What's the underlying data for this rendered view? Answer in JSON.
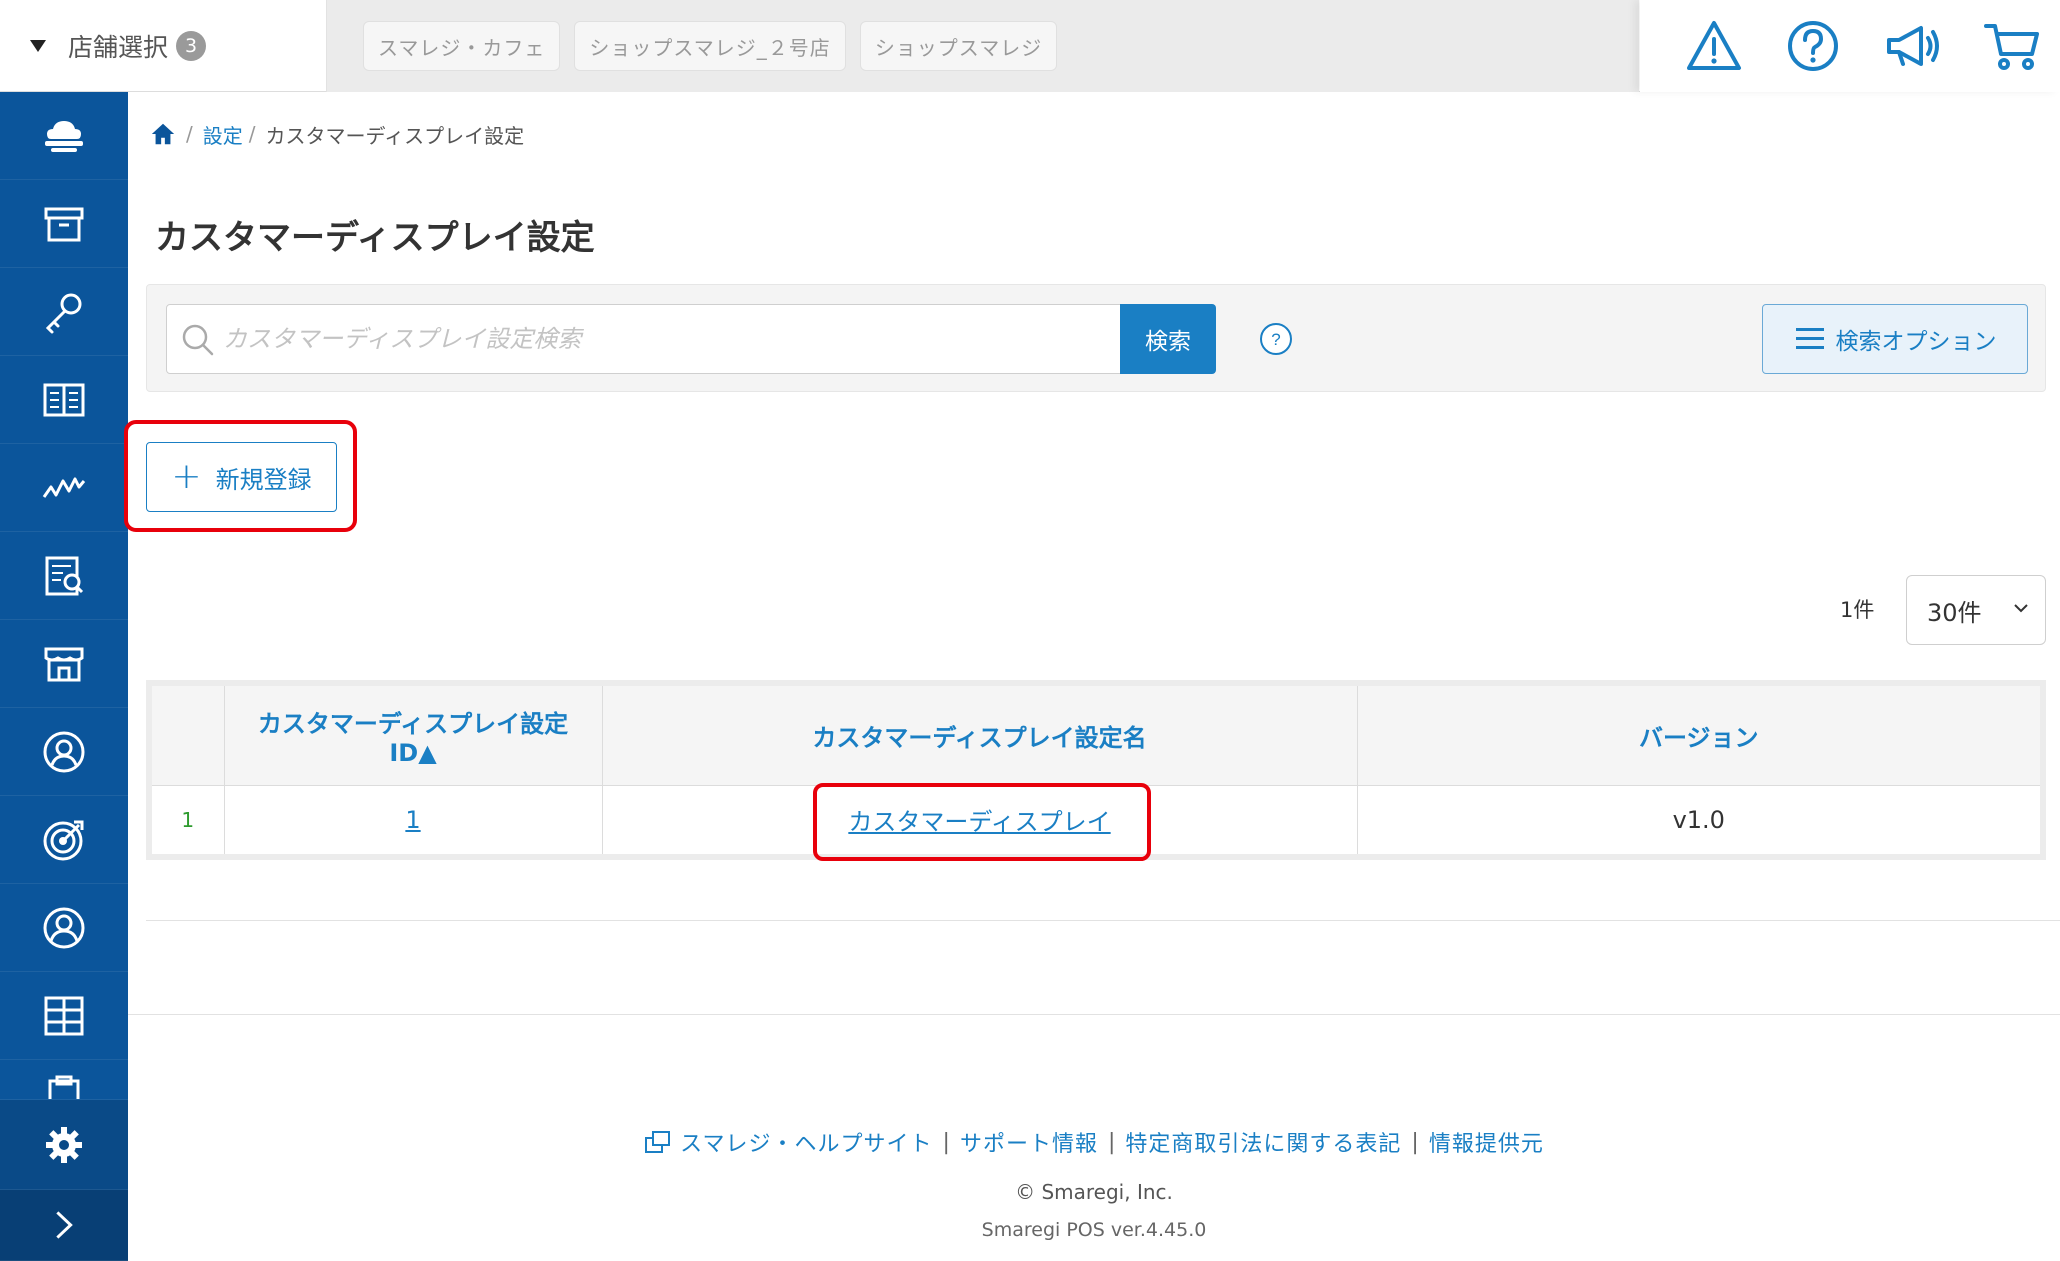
{
  "header": {
    "store_select_label": "店舗選択",
    "store_count": "3",
    "shop_tabs": [
      "スマレジ・カフェ",
      "ショップスマレジ_２号店",
      "ショップスマレジ"
    ],
    "icons": [
      "warning-icon",
      "help-icon",
      "megaphone-icon",
      "cart-icon"
    ]
  },
  "sidebar": {
    "items": [
      "cloud-icon",
      "box-icon",
      "key-icon",
      "book-icon",
      "chart-icon",
      "report-icon",
      "store-icon",
      "customer-icon",
      "target-icon",
      "user-icon",
      "grid-icon",
      "clipboard-icon"
    ],
    "bottom": [
      "gear-icon",
      "chevron-right-icon"
    ],
    "color": "#0b559b"
  },
  "breadcrumb": {
    "home_icon": "home-icon",
    "settings": "設定",
    "separator": "/",
    "current": "カスタマーディスプレイ設定"
  },
  "page": {
    "title": "カスタマーディスプレイ設定"
  },
  "search": {
    "placeholder": "カスタマーディスプレイ設定検索",
    "button": "検索",
    "help": "?",
    "options_button": "検索オプション"
  },
  "actions": {
    "new_button": "新規登録"
  },
  "pagination": {
    "count": "1件",
    "per_page": "30件"
  },
  "table": {
    "headers": [
      "",
      "カスタマーディスプレイ設定\nID▲",
      "カスタマーディスプレイ設定名",
      "バージョン"
    ],
    "header_id_line1": "カスタマーディスプレイ設定",
    "header_id_line2": "ID▲",
    "rows": [
      {
        "num": "1",
        "id": "1",
        "name": "カスタマーディスプレイ",
        "version": "v1.0"
      }
    ]
  },
  "footer": {
    "links": [
      "スマレジ・ヘルプサイト",
      "サポート情報",
      "特定商取引法に関する表記",
      "情報提供元"
    ],
    "separator": "|",
    "copyright": "© Smaregi, Inc.",
    "version": "Smaregi POS ver.4.45.0"
  },
  "colors": {
    "accent": "#1a7fc4",
    "highlight": "#e8000b",
    "sidebar": "#0b559b"
  }
}
